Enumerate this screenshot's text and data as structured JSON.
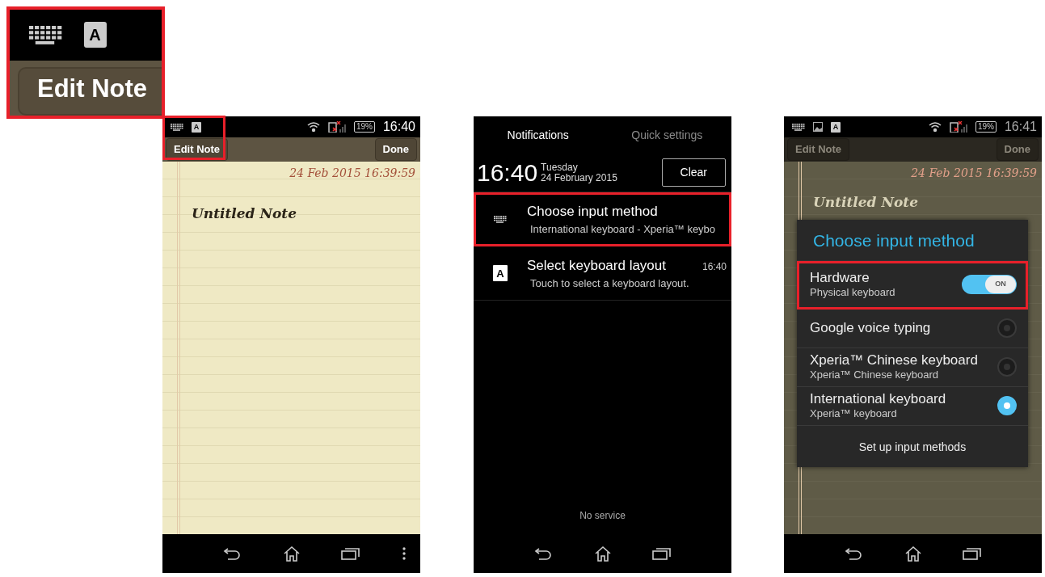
{
  "zoom_inset": {
    "status_icons": [
      {
        "kind": "keyboard"
      },
      {
        "kind": "letter",
        "letter": "A"
      }
    ],
    "button": "Edit Note",
    "highlighted": true
  },
  "note_screen": {
    "status_bar": {
      "icons": [
        {
          "kind": "keyboard"
        },
        {
          "kind": "letter",
          "letter": "A"
        }
      ],
      "battery": "19%",
      "time": "16:40"
    },
    "highlighted": true,
    "left_button": "Edit Note",
    "right_button": "Done",
    "timestamp": "24 Feb 2015 16:39:59",
    "title": "Untitled Note",
    "overflow_menu": true
  },
  "notification_screen": {
    "tabs": [
      {
        "label": "Notifications",
        "selected": true
      },
      {
        "label": "Quick settings",
        "selected": false
      }
    ],
    "clock": "16:40",
    "day": "Tuesday",
    "date": "24 February 2015",
    "clear_button": "Clear",
    "notifications": [
      {
        "kind": "keyboard",
        "title": "Choose input method",
        "text": "International keyboard - Xperia™ keybo",
        "highlighted": true
      },
      {
        "kind": "letter",
        "letter": "A",
        "title": "Select keyboard layout",
        "time": "16:40",
        "text": "Touch to select a keyboard layout.",
        "highlighted": false
      }
    ],
    "footer": "No service",
    "overflow_menu": false
  },
  "dialog_screen": {
    "status_bar": {
      "icons": [
        {
          "kind": "keyboard"
        },
        {
          "kind": "image"
        },
        {
          "kind": "letter",
          "letter": "A"
        }
      ],
      "battery": "19%",
      "time": "16:41"
    },
    "left_button": "Edit Note",
    "right_button": "Done",
    "timestamp": "24 Feb 2015 16:39:59",
    "title": "Untitled Note",
    "overflow_menu": false,
    "dialog": {
      "title": "Choose input method",
      "items": [
        {
          "kind": "switch",
          "title": "Hardware",
          "subtitle": "Physical keyboard",
          "on": true,
          "switch_label": "ON",
          "highlighted": true
        },
        {
          "kind": "radio",
          "title": "Google voice typing",
          "selected": false,
          "highlighted": false
        },
        {
          "kind": "radio",
          "title": "Xperia™ Chinese keyboard",
          "subtitle": "Xperia™ Chinese keyboard",
          "selected": false,
          "highlighted": false
        },
        {
          "kind": "radio",
          "title": "International keyboard",
          "subtitle": "Xperia™ keyboard",
          "selected": true,
          "highlighted": false
        }
      ],
      "footer_button": "Set up input methods"
    }
  }
}
